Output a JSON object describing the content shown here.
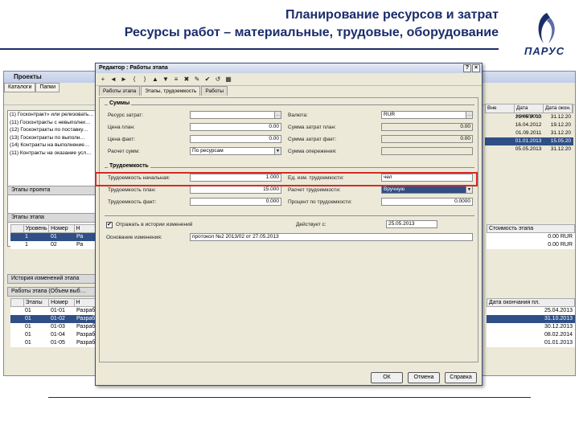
{
  "slide": {
    "title_line1": "Планирование ресурсов и затрат",
    "title_line2": "Ресурсы работ – материальные, трудовые, оборудование",
    "logo_text": "ПАРУС"
  },
  "bg_app": {
    "title": "Проекты",
    "tabs": [
      "Каталоги",
      "Папки"
    ],
    "projects_list": [
      "(1) Госконтракт» или релизовать…",
      "(11) Госконтракты с невыполни…",
      "(12) Госконтракты по поставку…",
      "(13) Госконтракты по выполн…",
      "(14) Контракты на выполнение…",
      "(11) Контракты на оказание усл…"
    ],
    "right_grid": {
      "headers": [
        "Вне",
        "Дата начала пл.",
        "Дата окон."
      ],
      "rows": [
        [
          "",
          "21.05.2012",
          "31.12.20"
        ],
        [
          "",
          "16.04.2012",
          "19.12.20"
        ],
        [
          "",
          "01.09.2011",
          "31.12.20"
        ],
        [
          "",
          "01.01.2013",
          "15.05.20"
        ],
        [
          "",
          "05.05.2013",
          "31.12.20"
        ]
      ],
      "selected_row": 3
    },
    "section1": "Этапы проекта",
    "section2": "Этапы этапа",
    "stage_table": {
      "headers": [
        "",
        "Уровень",
        "Номер",
        "Н"
      ],
      "rows": [
        [
          "",
          "1",
          "01",
          "Ра"
        ],
        [
          "",
          "1",
          "02",
          "Ра"
        ]
      ]
    },
    "stage_right": {
      "headers": [
        "Стоимость этапа"
      ],
      "rows": [
        "0.00 RUR",
        "0.00 RUR"
      ]
    },
    "history_tab": "История изменений этапа",
    "works_section": "Работы этапа (Объем выб…",
    "works_table": {
      "headers": [
        "",
        "Этапы",
        "Номер",
        "Н"
      ],
      "rows": [
        [
          "",
          "01",
          "01-01",
          "Разрабо"
        ],
        [
          "",
          "01",
          "01-02",
          "Разрабо"
        ],
        [
          "",
          "01",
          "01-03",
          "Разрабо"
        ],
        [
          "",
          "01",
          "01-04",
          "Разрабо"
        ],
        [
          "",
          "01",
          "01-05",
          "Разрабо"
        ]
      ],
      "selected_row": 1
    },
    "works_right": {
      "headers": [
        "Дата окончания пл."
      ],
      "rows": [
        "25.04.2013",
        "31.10.2013",
        "30.12.2013",
        "08.02.2014",
        "01.01.2013"
      ]
    }
  },
  "dialog": {
    "title": "Редактор : Работы этапа",
    "tabs": [
      "Работы этапа",
      "Этапы, трудоемкость",
      "Работы"
    ],
    "active_tab": 1,
    "toolbar_icons": [
      "+",
      "◄",
      "►",
      "⟨",
      "⟩",
      "▲",
      "▼",
      "≡",
      "✖",
      "✎",
      "✔",
      "↺",
      "▦"
    ],
    "group_sum": {
      "label": "Суммы",
      "left": [
        {
          "label": "Ресурс затрат:",
          "value": ""
        },
        {
          "label": "Цена план:",
          "value": "0.00"
        },
        {
          "label": "Цена факт:",
          "value": "0.00"
        },
        {
          "label": "Расчет сумм:",
          "value": "По ресурсам"
        }
      ],
      "right": [
        {
          "label": "Валюта:",
          "value": "RUR"
        },
        {
          "label": "Сумма затрат план:",
          "value": "0.00"
        },
        {
          "label": "Сумма затрат факт:",
          "value": "0.00"
        },
        {
          "label": "Сумма опережения:",
          "value": ""
        }
      ]
    },
    "group_labor": {
      "label": "Трудоемкость",
      "left": [
        {
          "label": "Трудоемкость начальная:",
          "value": "1.000"
        },
        {
          "label": "Трудоемкость план:",
          "value": "15.000"
        },
        {
          "label": "Трудоемкость факт:",
          "value": "0.000"
        }
      ],
      "right": [
        {
          "label": "Ед. изм. трудоемкости:",
          "value": "чел"
        },
        {
          "label": "Расчет трудоемкости:",
          "value": "Вручную"
        },
        {
          "label": "Процент по трудоемкости:",
          "value": "0.0000"
        }
      ]
    },
    "history": {
      "checkbox_label": "Отражать в истории изменений",
      "checked": true,
      "effective_label": "Действует с:",
      "effective_value": "25.05.2013",
      "basis_label": "Основание изменения:",
      "basis_value": "протокол №2 2013/02 от 27.05.2013"
    },
    "buttons": {
      "ok": "ОК",
      "cancel": "Отмена",
      "help": "Справка"
    }
  }
}
